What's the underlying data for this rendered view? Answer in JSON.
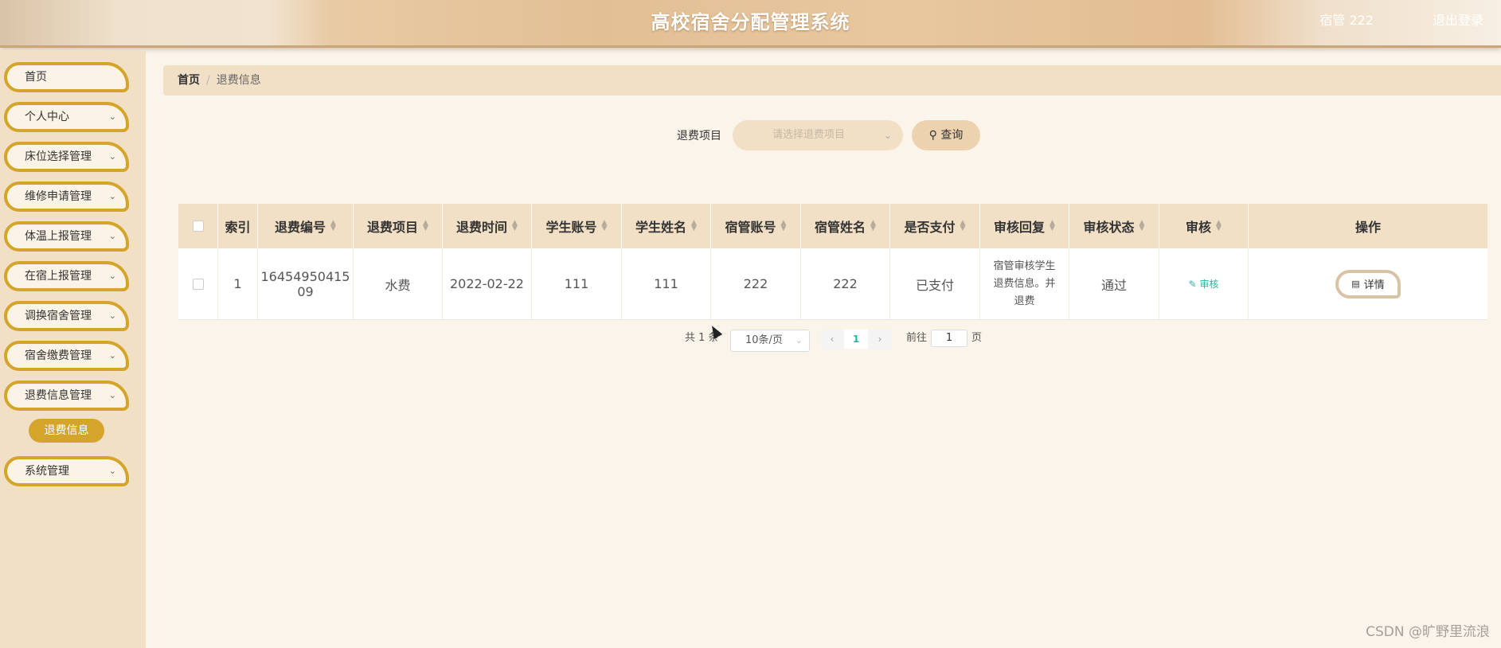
{
  "header": {
    "title": "高校宿舍分配管理系统",
    "user": "宿管 222",
    "logout": "退出登录"
  },
  "sidebar": {
    "items": [
      {
        "label": "首页",
        "has_chevron": false
      },
      {
        "label": "个人中心",
        "has_chevron": true
      },
      {
        "label": "床位选择管理",
        "has_chevron": true
      },
      {
        "label": "维修申请管理",
        "has_chevron": true
      },
      {
        "label": "体温上报管理",
        "has_chevron": true
      },
      {
        "label": "在宿上报管理",
        "has_chevron": true
      },
      {
        "label": "调换宿舍管理",
        "has_chevron": true
      },
      {
        "label": "宿舍缴费管理",
        "has_chevron": true
      },
      {
        "label": "退费信息管理",
        "has_chevron": true
      },
      {
        "label": "系统管理",
        "has_chevron": true
      }
    ],
    "active_sub": "退费信息"
  },
  "breadcrumb": {
    "home": "首页",
    "separator": "/",
    "current": "退费信息"
  },
  "search": {
    "label": "退费项目",
    "placeholder": "请选择退费项目",
    "button": "查询"
  },
  "table": {
    "headers": [
      "索引",
      "退费编号",
      "退费项目",
      "退费时间",
      "学生账号",
      "学生姓名",
      "宿管账号",
      "宿管姓名",
      "是否支付",
      "审核回复",
      "审核状态",
      "审核",
      "操作"
    ],
    "rows": [
      {
        "index": "1",
        "refund_no": "1645495041509",
        "refund_no_line1": "16454950415",
        "refund_no_line2": "09",
        "item": "水费",
        "time": "2022-02-22",
        "student_account": "111",
        "student_name": "111",
        "manager_account": "222",
        "manager_name": "222",
        "paid": "已支付",
        "reply_line1": "宿管审核学生",
        "reply_line2": "退费信息。并",
        "reply_line3": "退费",
        "status": "通过",
        "audit": "审核",
        "action": "详情"
      }
    ]
  },
  "pagination": {
    "total": "共 1 条",
    "page_size": "10条/页",
    "current_page": "1",
    "goto_label": "前往",
    "goto_value": "1",
    "goto_suffix": "页"
  },
  "watermark": "CSDN @旷野里流浪",
  "colors": {
    "accent": "#d4a52a",
    "header_bg": "#e3bf95",
    "sidebar_bg": "#f1dfc6",
    "link": "#2bb5a0"
  },
  "icons": {
    "chevron": "chevron-down-icon",
    "search": "search-icon",
    "edit": "edit-icon",
    "detail": "document-icon"
  }
}
